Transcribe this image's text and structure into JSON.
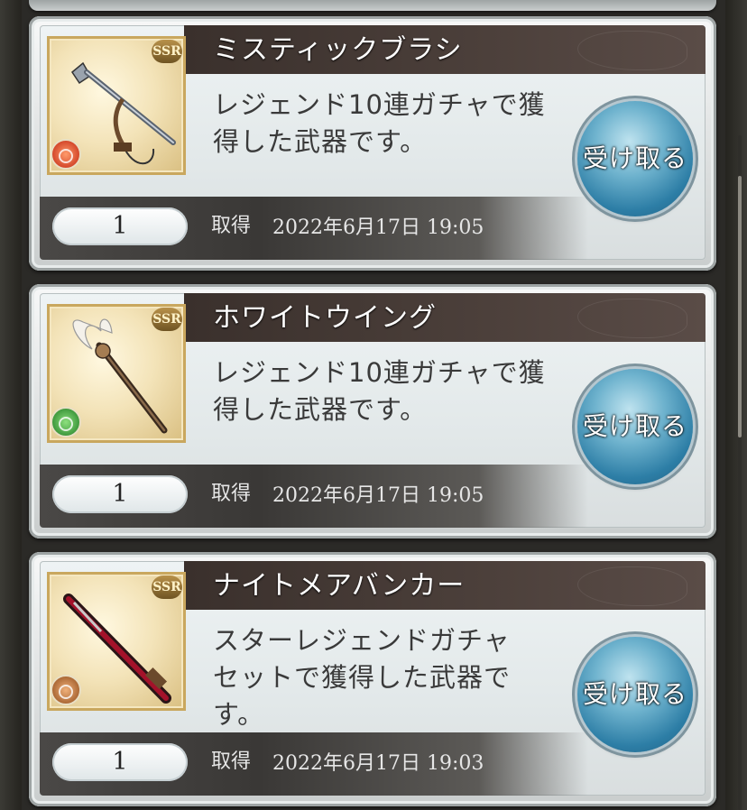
{
  "items": [
    {
      "name": "ミスティックブラシ",
      "description_line1": "レジェンド10連ガチャで獲",
      "description_line2": "得した武器です。",
      "description_line3": "",
      "rarity": "SSR",
      "element": "fire",
      "quantity": "1",
      "acquired_label": "取得",
      "acquired_date": "2022年6月17日 19:05",
      "receive_label": "受け取る"
    },
    {
      "name": "ホワイトウイング",
      "description_line1": "レジェンド10連ガチャで獲",
      "description_line2": "得した武器です。",
      "description_line3": "",
      "rarity": "SSR",
      "element": "wind",
      "quantity": "1",
      "acquired_label": "取得",
      "acquired_date": "2022年6月17日 19:05",
      "receive_label": "受け取る"
    },
    {
      "name": "ナイトメアバンカー",
      "description_line1": "スターレジェンドガチャ",
      "description_line2": "セットで獲得した武器で",
      "description_line3": "す。",
      "rarity": "SSR",
      "element": "earth",
      "quantity": "1",
      "acquired_label": "取得",
      "acquired_date": "2022年6月17日 19:03",
      "receive_label": "受け取る"
    }
  ],
  "colors": {
    "title_bar": "#3a302c",
    "receive_button": "#2d7ea6",
    "background": "#2b2a27"
  }
}
